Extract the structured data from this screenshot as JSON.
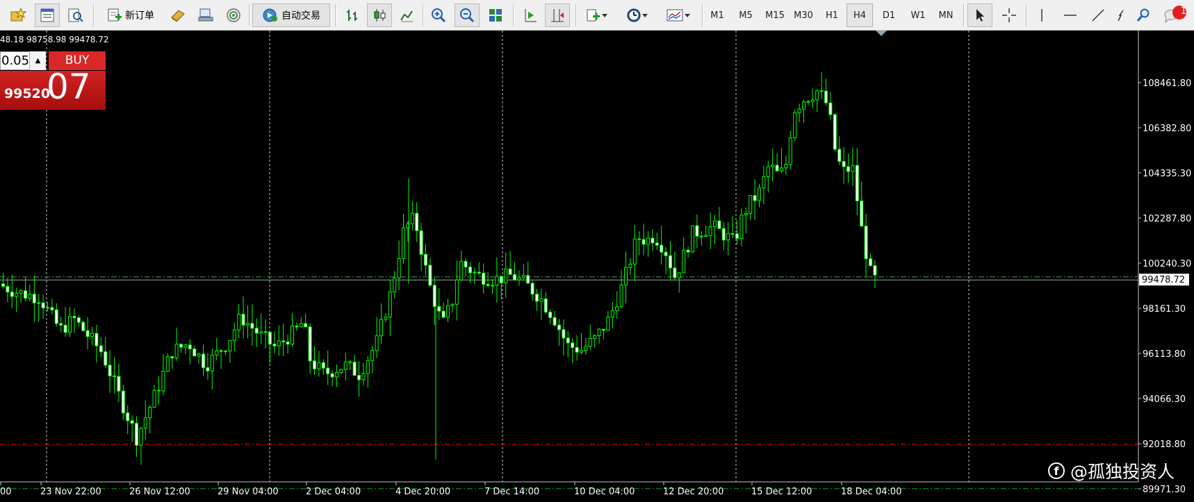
{
  "toolbar": {
    "new_order_label": "新订单",
    "auto_trading_label": "自动交易",
    "timeframes": [
      {
        "label": "M1",
        "active": false
      },
      {
        "label": "M5",
        "active": false
      },
      {
        "label": "M15",
        "active": false
      },
      {
        "label": "M30",
        "active": false
      },
      {
        "label": "H1",
        "active": false
      },
      {
        "label": "H4",
        "active": true
      },
      {
        "label": "D1",
        "active": false
      },
      {
        "label": "W1",
        "active": false
      },
      {
        "label": "MN",
        "active": false
      }
    ],
    "notification_count": "1"
  },
  "chart": {
    "ohlc_text": "48.18 98758.98 99478.72",
    "current_price": "99478.72",
    "price_labels": [
      "108461.80",
      "106382.80",
      "104335.30",
      "102287.80",
      "100240.30",
      "98161.30",
      "96113.80",
      "94066.30",
      "92018.80",
      "89971.30"
    ],
    "time_labels": [
      "00",
      "23 Nov 22:00",
      "26 Nov 12:00",
      "29 Nov 04:00",
      "2 Dec 04:00",
      "4 Dec 20:00",
      "7 Dec 14:00",
      "10 Dec 04:00",
      "12 Dec 20:00",
      "15 Dec 12:00",
      "18 Dec 04:00"
    ],
    "lines": {
      "current_price": 99478.72,
      "ask_line": 99620,
      "red_line": 92000,
      "green_line": 89980
    },
    "colors": {
      "candle": "#00ff00",
      "background": "#000000",
      "grid": "#c8c8c8",
      "red_line": "#ff0000",
      "green_line": "#00b000"
    }
  },
  "trade_panel": {
    "lot": "0.05",
    "buy_label": "BUY",
    "price_small": "99520",
    "price_big": "07"
  },
  "watermark": {
    "text": "@孤独投资人"
  }
}
